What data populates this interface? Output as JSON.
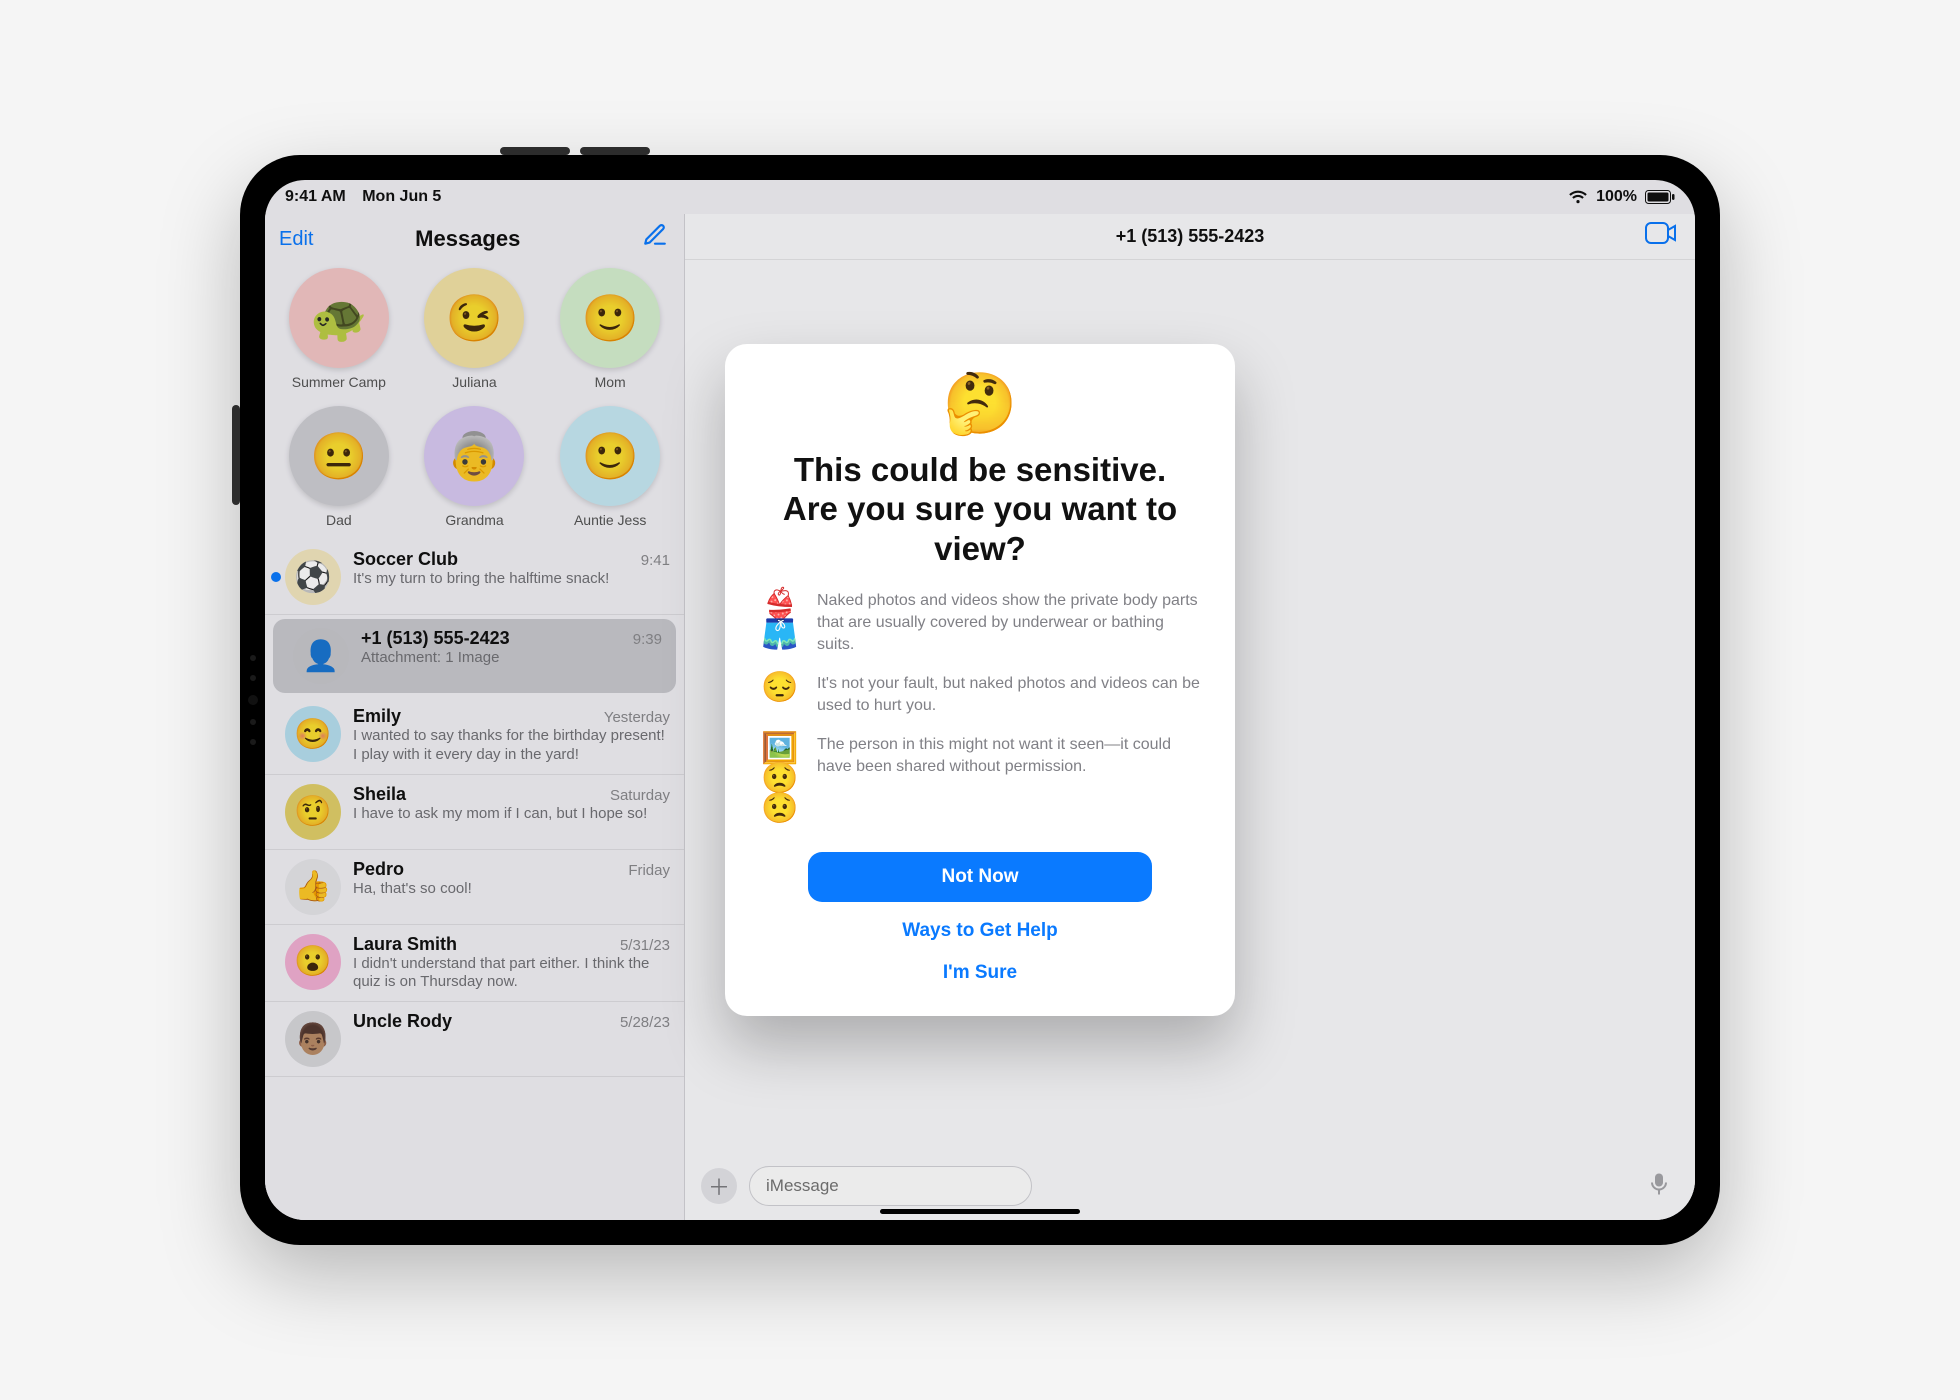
{
  "status": {
    "time": "9:41 AM",
    "date": "Mon Jun 5",
    "battery": "100%"
  },
  "sidebar": {
    "edit": "Edit",
    "title": "Messages",
    "pinned": [
      {
        "name": "Summer Camp",
        "emoji": "🐢",
        "bg": "#f5c7c7"
      },
      {
        "name": "Juliana",
        "emoji": "😉",
        "bg": "#f3e3a7"
      },
      {
        "name": "Mom",
        "emoji": "🙂",
        "bg": "#d6f0d0"
      },
      {
        "name": "Dad",
        "emoji": "😐",
        "bg": "#cfcfd4"
      },
      {
        "name": "Grandma",
        "emoji": "👵",
        "bg": "#d9caf4"
      },
      {
        "name": "Auntie Jess",
        "emoji": "🙂",
        "bg": "#c7eaf5"
      }
    ],
    "threads": [
      {
        "name": "Soccer Club",
        "time": "9:41",
        "preview": "It's my turn to bring the halftime snack!",
        "emoji": "⚽",
        "bg": "#f4e8bf",
        "unread": true
      },
      {
        "name": "+1 (513) 555-2423",
        "time": "9:39",
        "preview": "Attachment: 1 Image",
        "emoji": "👤",
        "bg": "#c8c8cd",
        "selected": true
      },
      {
        "name": "Emily",
        "time": "Yesterday",
        "preview": "I wanted to say thanks for the birthday present! I play with it every day in the yard!",
        "emoji": "😊",
        "bg": "#b7e0f0"
      },
      {
        "name": "Sheila",
        "time": "Saturday",
        "preview": "I have to ask my mom if I can, but I hope so!",
        "emoji": "🤨",
        "bg": "#e2d06a"
      },
      {
        "name": "Pedro",
        "time": "Friday",
        "preview": "Ha, that's so cool!",
        "emoji": "👍",
        "bg": "#e6e6ea"
      },
      {
        "name": "Laura Smith",
        "time": "5/31/23",
        "preview": "I didn't understand that part either. I think the quiz is on Thursday now.",
        "emoji": "😮",
        "bg": "#f2b0d4"
      },
      {
        "name": "Uncle Rody",
        "time": "5/28/23",
        "preview": "",
        "emoji": "👨🏽",
        "bg": "#d8d8dc"
      }
    ]
  },
  "conversation": {
    "title": "+1 (513) 555-2423",
    "input_placeholder": "iMessage"
  },
  "dialog": {
    "emoji": "🤔",
    "title": "This could be sensitive. Are you sure you want to view?",
    "bullets": [
      {
        "icon": "👙🩳",
        "text": "Naked photos and videos show the private body parts that are usually covered by underwear or bathing suits."
      },
      {
        "icon": "😔",
        "text": "It's not your fault, but naked photos and videos can be used to hurt you."
      },
      {
        "icon": "🖼️😟😟",
        "text": "The person in this might not want it seen—it could have been shared without permission."
      }
    ],
    "primary": "Not Now",
    "help": "Ways to Get Help",
    "confirm": "I'm Sure"
  }
}
